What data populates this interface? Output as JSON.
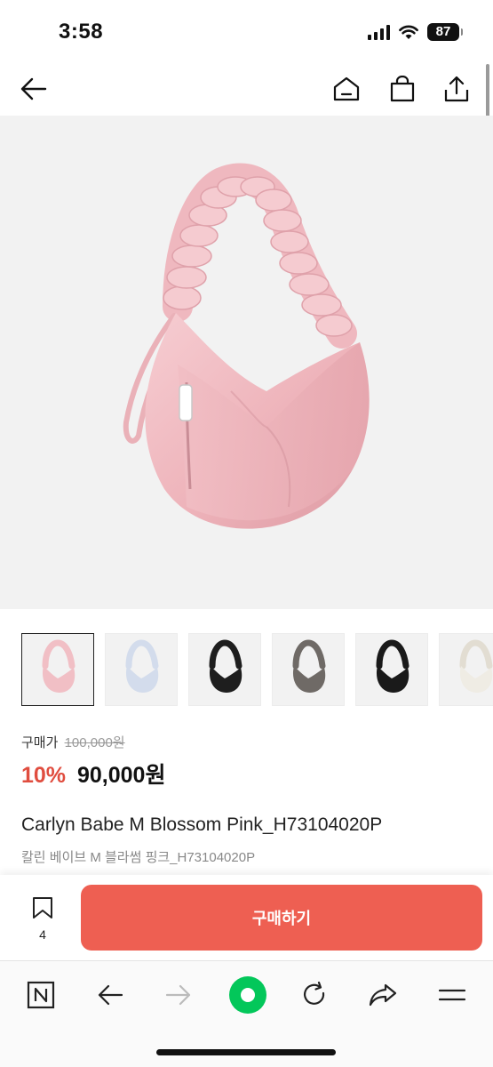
{
  "status_bar": {
    "time": "3:58",
    "battery": "87"
  },
  "product": {
    "price_label": "구매가",
    "original_price": "100,000원",
    "discount": "10%",
    "sale_price": "90,000원",
    "title": "Carlyn Babe M Blossom Pink_H73104020P",
    "subtitle": "칼린 베이브 M 블라썸 핑크_H73104020P",
    "selected_thumbnail": 0,
    "thumbnail_colors": [
      "#f1bfc5",
      "#d3dcec",
      "#1e1e1e",
      "#6f6a66",
      "#1a1a1a",
      "#efece4"
    ]
  },
  "purchase_bar": {
    "bookmark_count": "4",
    "buy_label": "구매하기"
  },
  "colors": {
    "accent": "#ee5f52",
    "discount": "#e04d3f",
    "naver_green": "#03c75a"
  },
  "icons": {
    "top_nav": [
      "arrow-left-icon",
      "home-icon",
      "shopping-bag-icon",
      "share-icon"
    ],
    "toolbar": [
      "naver-n-icon",
      "back-arrow-icon",
      "forward-arrow-icon",
      "naver-green-dot-icon",
      "refresh-icon",
      "share-arrow-icon",
      "menu-icon"
    ]
  }
}
